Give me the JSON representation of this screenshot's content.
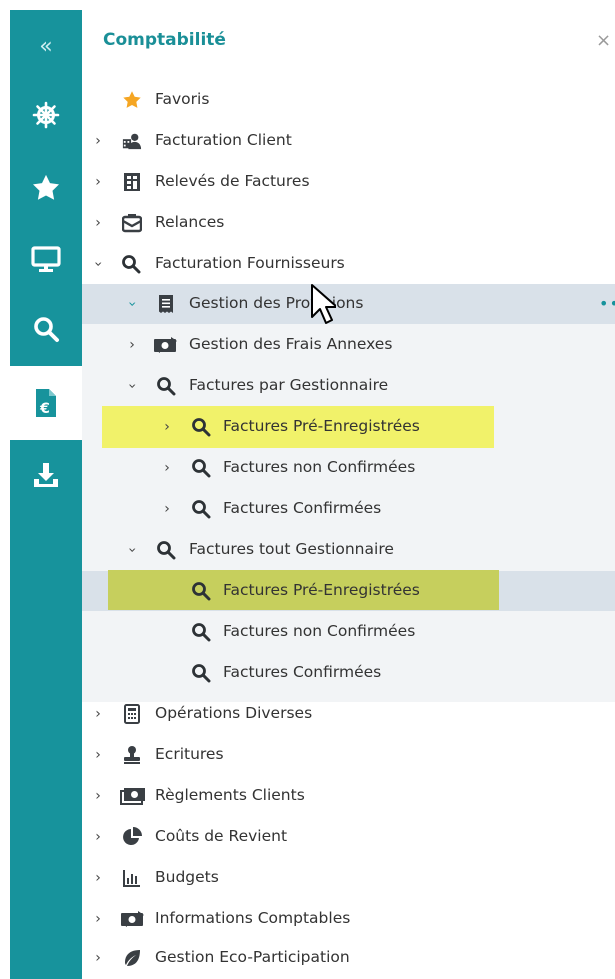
{
  "sidebar": {
    "collapse_glyph": "«",
    "icons": [
      "helm-icon",
      "star-icon",
      "monitor-icon",
      "search-icon",
      "invoice-euro-icon",
      "download-icon"
    ],
    "active_index": 4
  },
  "panel": {
    "title": "Comptabilité",
    "close_glyph": "×"
  },
  "tree": {
    "favoris": "Favoris",
    "facturation_client": "Facturation Client",
    "releves": "Relevés de Factures",
    "relances": "Relances",
    "facturation_fournisseurs": "Facturation Fournisseurs",
    "gestion_provisions": "Gestion des Provisions",
    "gestion_frais": "Gestion des Frais Annexes",
    "factures_par_gestionnaire": "Factures par Gestionnaire",
    "fpg_pre": "Factures Pré-Enregistrées",
    "fpg_non": "Factures non Confirmées",
    "fpg_conf": "Factures Confirmées",
    "factures_tout": "Factures tout Gestionnaire",
    "ftg_pre": "Factures Pré-Enregistrées",
    "ftg_non": "Factures non Confirmées",
    "ftg_conf": "Factures Confirmées",
    "operations": "Opérations Diverses",
    "ecritures": "Ecritures",
    "reglements": "Règlements Clients",
    "couts": "Coûts de Revient",
    "budgets": "Budgets",
    "infos": "Informations Comptables",
    "eco": "Gestion Eco-Participation",
    "more_glyph": "••"
  },
  "colors": {
    "teal": "#17939c",
    "selected_row": "#d9e1e9",
    "highlight_yellow": "#f1f26a",
    "highlight_olive": "#c6cf5d"
  }
}
